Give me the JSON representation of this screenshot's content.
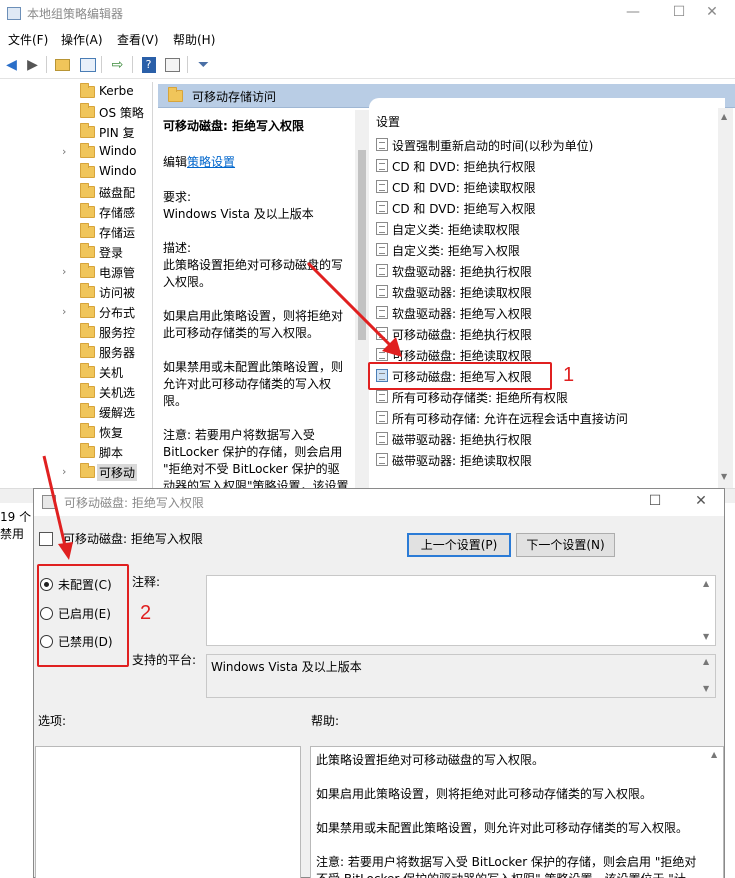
{
  "window": {
    "title": "本地组策略编辑器",
    "controls": {
      "minimize": "—",
      "maximize": "☐",
      "close": "✕"
    }
  },
  "menu": [
    "文件(F)",
    "操作(A)",
    "查看(V)",
    "帮助(H)"
  ],
  "tree": {
    "items": [
      {
        "label": "Kerbe",
        "expand": ""
      },
      {
        "label": "OS 策略",
        "expand": ""
      },
      {
        "label": "PIN 复",
        "expand": ""
      },
      {
        "label": "Windo",
        "expand": "›"
      },
      {
        "label": "Windo",
        "expand": ""
      },
      {
        "label": "磁盘配",
        "expand": ""
      },
      {
        "label": "存储感",
        "expand": ""
      },
      {
        "label": "存储运",
        "expand": ""
      },
      {
        "label": "登录",
        "expand": ""
      },
      {
        "label": "电源管",
        "expand": "›"
      },
      {
        "label": "访问被",
        "expand": ""
      },
      {
        "label": "分布式",
        "expand": "›"
      },
      {
        "label": "服务控",
        "expand": ""
      },
      {
        "label": "服务器",
        "expand": ""
      },
      {
        "label": "关机",
        "expand": ""
      },
      {
        "label": "关机选",
        "expand": ""
      },
      {
        "label": "缓解选",
        "expand": ""
      },
      {
        "label": "恢复",
        "expand": ""
      },
      {
        "label": "脚本",
        "expand": ""
      },
      {
        "label": "可移动",
        "expand": "›"
      }
    ]
  },
  "panel": {
    "header": "可移动存储访问",
    "desc": {
      "title": "可移动磁盘: 拒绝写入权限",
      "edit_prefix": "编辑",
      "edit_link": "策略设置",
      "req_label": "要求:",
      "req_value": "Windows Vista 及以上版本",
      "desc_label": "描述:",
      "lines": [
        "此策略设置拒绝对可移动磁盘的写",
        "入权限。",
        "",
        "如果启用此策略设置，则将拒绝对",
        "此可移动存储类的写入权限。",
        "",
        "如果禁用或未配置此策略设置，则",
        "允许对此可移动存储类的写入权",
        "限。",
        "",
        "注意: 若要用户将数据写入受",
        "BitLocker 保护的存储，则会启用",
        "\"拒绝对不受 BitLocker 保护的驱",
        "动器的写入权限\"策略设置，该设置"
      ]
    },
    "settings_header": "设置",
    "settings": [
      "设置强制重新启动的时间(以秒为单位)",
      "CD 和 DVD: 拒绝执行权限",
      "CD 和 DVD: 拒绝读取权限",
      "CD 和 DVD: 拒绝写入权限",
      "自定义类: 拒绝读取权限",
      "自定义类: 拒绝写入权限",
      "软盘驱动器: 拒绝执行权限",
      "软盘驱动器: 拒绝读取权限",
      "软盘驱动器: 拒绝写入权限",
      "可移动磁盘: 拒绝执行权限",
      "可移动磁盘: 拒绝读取权限",
      "可移动磁盘: 拒绝写入权限",
      "所有可移动存储类: 拒绝所有权限",
      "所有可移动存储: 允许在远程会话中直接访问",
      "磁带驱动器: 拒绝执行权限",
      "磁带驱动器: 拒绝读取权限"
    ]
  },
  "status": {
    "count": "19 个",
    "partial": "禁用"
  },
  "annotations": {
    "one": "1",
    "two": "2",
    "color": "#e02020"
  },
  "dialog": {
    "title": "可移动磁盘: 拒绝写入权限",
    "subtitle": "可移动磁盘: 拒绝写入权限",
    "controls": {
      "maximize": "☐",
      "close": "✕"
    },
    "prev_button": "上一个设置(P)",
    "next_button": "下一个设置(N)",
    "radios": [
      {
        "label": "未配置(C)",
        "checked": true
      },
      {
        "label": "已启用(E)",
        "checked": false
      },
      {
        "label": "已禁用(D)",
        "checked": false
      }
    ],
    "comment_label": "注释:",
    "comment_value": "",
    "platform_label": "支持的平台:",
    "platform_value": "Windows Vista 及以上版本",
    "options_label": "选项:",
    "help_label": "帮助:",
    "help_lines": [
      "此策略设置拒绝对可移动磁盘的写入权限。",
      "",
      "如果启用此策略设置，则将拒绝对此可移动存储类的写入权限。",
      "",
      "如果禁用或未配置此策略设置，则允许对此可移动存储类的写入权限。",
      "",
      "注意: 若要用户将数据写入受 BitLocker 保护的存储，则会启用 \"拒绝对",
      "不受 BitLocker 保护的驱动器的写入权限\" 策略设置，该设置位于 \"计"
    ]
  }
}
